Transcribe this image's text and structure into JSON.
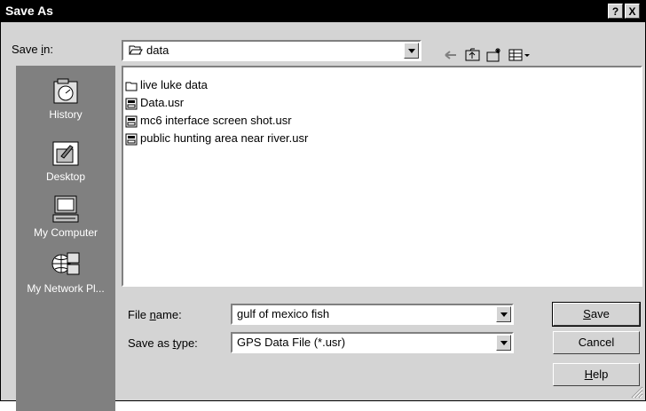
{
  "window": {
    "title": "Save As",
    "help_glyph": "?",
    "close_glyph": "X"
  },
  "savein": {
    "label_pre": "Save ",
    "label_u": "i",
    "label_post": "n:",
    "value": "data"
  },
  "places": [
    {
      "label": "History",
      "icon": "history-icon"
    },
    {
      "label": "Desktop",
      "icon": "desktop-icon"
    },
    {
      "label": "My Computer",
      "icon": "my-computer-icon"
    },
    {
      "label": "My Network Pl...",
      "icon": "network-icon"
    }
  ],
  "files": [
    {
      "name": "live luke data",
      "icon": "folder-icon"
    },
    {
      "name": "Data.usr",
      "icon": "usr-file-icon"
    },
    {
      "name": "mc6 interface screen shot.usr",
      "icon": "usr-file-icon"
    },
    {
      "name": "public hunting area near river.usr",
      "icon": "usr-file-icon"
    }
  ],
  "filename": {
    "label_pre": "File ",
    "label_u": "n",
    "label_post": "ame:",
    "value": "gulf of mexico fish"
  },
  "savetype": {
    "label_pre": "Save as ",
    "label_u": "t",
    "label_post": "ype:",
    "value": "GPS Data File (*.usr)"
  },
  "buttons": {
    "save_u": "S",
    "save_rest": "ave",
    "cancel": "Cancel",
    "help_u": "H",
    "help_rest": "elp"
  }
}
